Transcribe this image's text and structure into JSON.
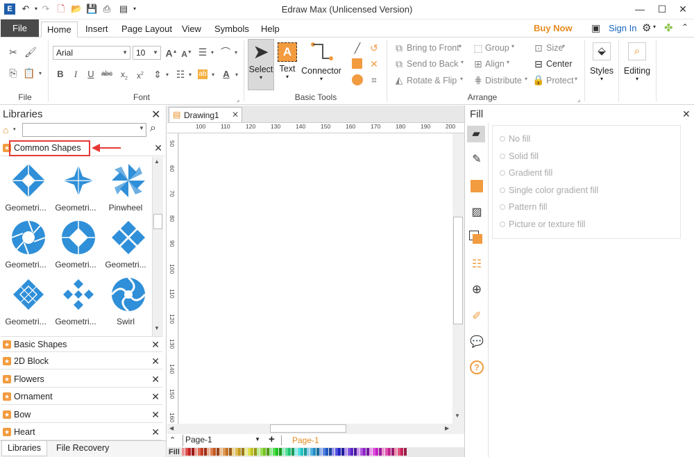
{
  "window": {
    "title": "Edraw Max (Unlicensed Version)"
  },
  "tabs": [
    {
      "label": "File"
    },
    {
      "label": "Home"
    },
    {
      "label": "Insert"
    },
    {
      "label": "Page Layout"
    },
    {
      "label": "View"
    },
    {
      "label": "Symbols"
    },
    {
      "label": "Help"
    }
  ],
  "header_right": {
    "buy_now": "Buy Now",
    "sign_in": "Sign In"
  },
  "ribbon": {
    "groups": {
      "file": "File",
      "font": "Font",
      "basic_tools": "Basic Tools",
      "arrange": "Arrange"
    },
    "font": {
      "family": "Arial",
      "size": "10"
    },
    "basic_tools": {
      "select": "Select",
      "text": "Text",
      "connector": "Connector"
    },
    "arrange": {
      "bring_to_front": "Bring to Front",
      "send_to_back": "Send to Back",
      "rotate_flip": "Rotate & Flip",
      "group": "Group",
      "align": "Align",
      "distribute": "Distribute",
      "size": "Size",
      "center": "Center",
      "protect": "Protect"
    },
    "styles": "Styles",
    "editing": "Editing"
  },
  "libraries": {
    "title": "Libraries",
    "search_placeholder": "",
    "open_library": "Common Shapes",
    "shapes": [
      {
        "label": "Geometri..."
      },
      {
        "label": "Geometri..."
      },
      {
        "label": "Pinwheel"
      },
      {
        "label": "Geometri..."
      },
      {
        "label": "Geometri..."
      },
      {
        "label": "Geometri..."
      },
      {
        "label": "Geometri..."
      },
      {
        "label": "Geometri..."
      },
      {
        "label": "Swirl"
      }
    ],
    "collapsed": [
      {
        "label": "Basic Shapes"
      },
      {
        "label": "2D Block"
      },
      {
        "label": "Flowers"
      },
      {
        "label": "Ornament"
      },
      {
        "label": "Bow"
      },
      {
        "label": "Heart"
      }
    ],
    "bottom_tabs": {
      "libraries": "Libraries",
      "file_recovery": "File Recovery"
    }
  },
  "document": {
    "tab": "Drawing1",
    "h_ticks": [
      "100",
      "110",
      "120",
      "130",
      "140",
      "150",
      "160",
      "170",
      "180",
      "190",
      "200"
    ],
    "v_ticks": [
      "50",
      "60",
      "70",
      "80",
      "90",
      "100",
      "110",
      "120",
      "130",
      "140",
      "150",
      "160"
    ],
    "page_dropdown": "Page-1",
    "active_page": "Page-1",
    "fill_label": "Fill"
  },
  "fill_panel": {
    "title": "Fill",
    "options": [
      "No fill",
      "Solid fill",
      "Gradient fill",
      "Single color gradient fill",
      "Pattern fill",
      "Picture or texture fill"
    ]
  },
  "colors": {
    "accent": "#2f8fd8",
    "orange": "#f29b3f",
    "highlight": "#e53935",
    "file_tab": "#4a4a4a"
  }
}
